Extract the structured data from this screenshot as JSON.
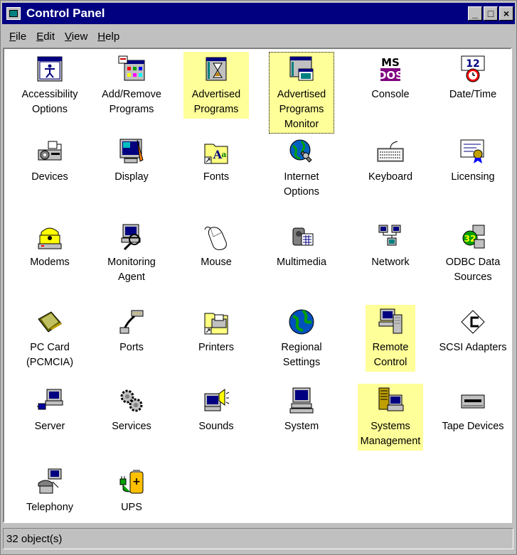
{
  "window": {
    "title": "Control Panel",
    "controls": [
      "_",
      "□",
      "×"
    ]
  },
  "menu": [
    "File",
    "Edit",
    "View",
    "Help"
  ],
  "items": [
    {
      "label": "Accessibility\nOptions",
      "icon": "accessibility-icon"
    },
    {
      "label": "Add/Remove\nPrograms",
      "icon": "add-remove-programs-icon"
    },
    {
      "label": "Advertised\nPrograms",
      "icon": "advertised-programs-icon",
      "highlighted": true
    },
    {
      "label": "Advertised\nPrograms\nMonitor",
      "icon": "advertised-programs-monitor-icon",
      "highlighted": true,
      "focused": true
    },
    {
      "label": "Console",
      "icon": "console-icon"
    },
    {
      "label": "Date/Time",
      "icon": "date-time-icon"
    },
    {
      "label": "Devices",
      "icon": "devices-icon"
    },
    {
      "label": "Display",
      "icon": "display-icon"
    },
    {
      "label": "Fonts",
      "icon": "fonts-icon"
    },
    {
      "label": "Internet\nOptions",
      "icon": "internet-options-icon"
    },
    {
      "label": "Keyboard",
      "icon": "keyboard-icon"
    },
    {
      "label": "Licensing",
      "icon": "licensing-icon"
    },
    {
      "label": "Modems",
      "icon": "modems-icon"
    },
    {
      "label": "Monitoring\nAgent",
      "icon": "monitoring-agent-icon"
    },
    {
      "label": "Mouse",
      "icon": "mouse-icon"
    },
    {
      "label": "Multimedia",
      "icon": "multimedia-icon"
    },
    {
      "label": "Network",
      "icon": "network-icon"
    },
    {
      "label": "ODBC Data\nSources",
      "icon": "odbc-icon"
    },
    {
      "label": "PC Card\n(PCMCIA)",
      "icon": "pc-card-icon"
    },
    {
      "label": "Ports",
      "icon": "ports-icon"
    },
    {
      "label": "Printers",
      "icon": "printers-icon"
    },
    {
      "label": "Regional\nSettings",
      "icon": "regional-settings-icon"
    },
    {
      "label": "Remote\nControl",
      "icon": "remote-control-icon",
      "highlighted": true
    },
    {
      "label": "SCSI Adapters",
      "icon": "scsi-adapters-icon"
    },
    {
      "label": "Server",
      "icon": "server-icon"
    },
    {
      "label": "Services",
      "icon": "services-icon"
    },
    {
      "label": "Sounds",
      "icon": "sounds-icon"
    },
    {
      "label": "System",
      "icon": "system-icon"
    },
    {
      "label": "Systems\nManagement",
      "icon": "systems-management-icon",
      "highlighted": true
    },
    {
      "label": "Tape Devices",
      "icon": "tape-devices-icon"
    },
    {
      "label": "Telephony",
      "icon": "telephony-icon"
    },
    {
      "label": "UPS",
      "icon": "ups-icon"
    }
  ],
  "status": {
    "text": "32 object(s)"
  },
  "colors": {
    "titlebar": "#000080",
    "highlight": "#ffff99",
    "chrome": "#c0c0c0"
  }
}
